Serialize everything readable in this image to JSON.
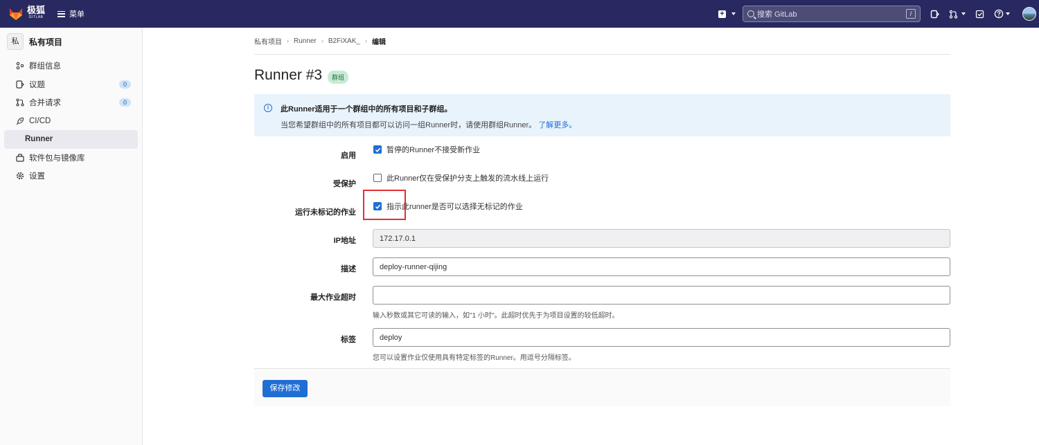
{
  "topbar": {
    "brand_text": "极狐",
    "brand_sub": "GITLAB",
    "menu_label": "菜单",
    "search_placeholder": "搜索 GitLab",
    "search_shortcut": "/"
  },
  "sidebar": {
    "project_avatar": "私",
    "project_name": "私有项目",
    "items": [
      {
        "label": "群组信息"
      },
      {
        "label": "议题",
        "badge": "0"
      },
      {
        "label": "合并请求",
        "badge": "0"
      },
      {
        "label": "CI/CD"
      },
      {
        "label": "Runner"
      },
      {
        "label": "软件包与镜像库"
      },
      {
        "label": "设置"
      }
    ]
  },
  "breadcrumb": [
    "私有项目",
    "Runner",
    "B2FiXAK_",
    "编辑"
  ],
  "page": {
    "title": "Runner #3",
    "badge": "群组"
  },
  "alert": {
    "line1": "此Runner适用于一个群组中的所有项目和子群组。",
    "line2": "当您希望群组中的所有项目都可以访问一组Runner时，请使用群组Runner。",
    "link": "了解更多。"
  },
  "form": {
    "active": {
      "label": "启用",
      "text": "暂停的Runner不接受新作业",
      "checked": true
    },
    "protected": {
      "label": "受保护",
      "text": "此Runner仅在受保护分支上触发的流水线上运行",
      "checked": false
    },
    "untagged": {
      "label": "运行未标记的作业",
      "text": "指示此runner是否可以选择无标记的作业",
      "checked": true
    },
    "ip": {
      "label": "IP地址",
      "value": "172.17.0.1"
    },
    "description": {
      "label": "描述",
      "value": "deploy-runner-qijing"
    },
    "timeout": {
      "label": "最大作业超时",
      "value": "",
      "help": "输入秒数或其它可读的输入，如\"1 小时\"。此超时优先于为项目设置的较低超时。"
    },
    "tags": {
      "label": "标签",
      "value": "deploy",
      "help": "您可以设置作业仅使用具有特定标签的Runner。用逗号分隔标签。"
    }
  },
  "save_button": "保存修改",
  "colors": {
    "navbar": "#292961",
    "primary": "#1f6ed4",
    "highlight": "#e03131"
  }
}
